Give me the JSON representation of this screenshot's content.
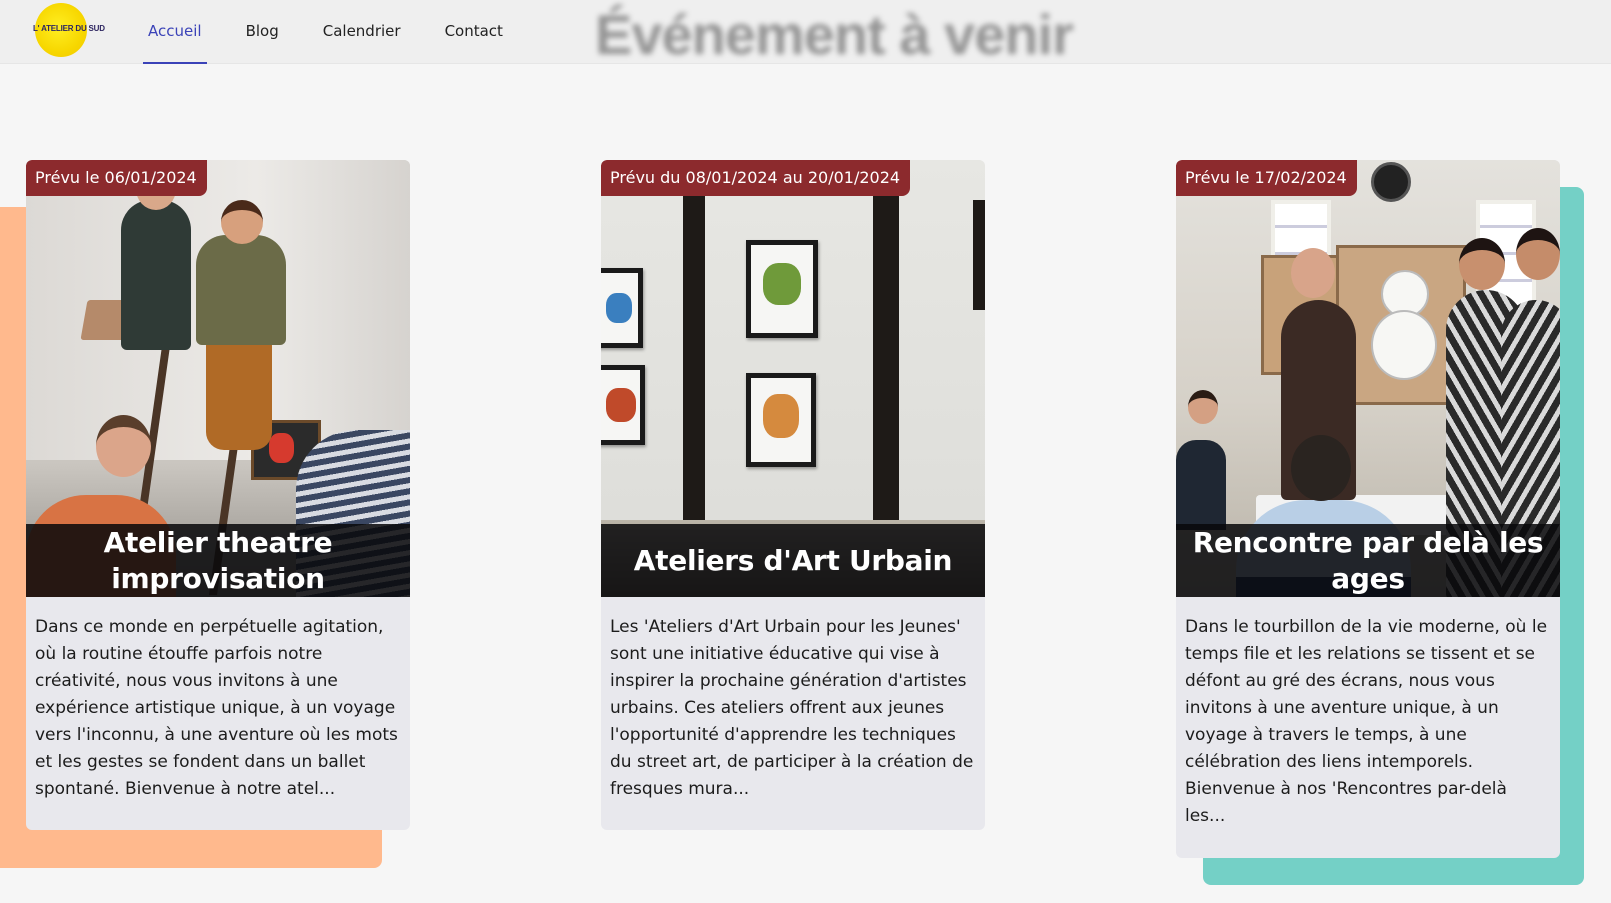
{
  "header": {
    "logo_text": "L' ATELIER DU SUD",
    "nav": [
      {
        "label": "Accueil",
        "active": true
      },
      {
        "label": "Blog",
        "active": false
      },
      {
        "label": "Calendrier",
        "active": false
      },
      {
        "label": "Contact",
        "active": false
      }
    ],
    "background_title": "Événement à venir"
  },
  "colors": {
    "accent": "#3b43b8",
    "badge": "#8c2a2d",
    "deco_orange": "#ffb98d",
    "deco_teal": "#74d0c6",
    "card_bg": "#e8e8ed"
  },
  "events": [
    {
      "date_label": "Prévu le 06/01/2024",
      "title": "Atelier theatre improvisation",
      "description": "Dans ce monde en perpétuelle agitation, où la routine étouffe parfois notre créativité, nous vous invitons à une expérience artistique unique, à un voyage vers l'inconnu, à une aventure où les mots et les gestes se fondent dans un ballet spontané. Bienvenue à notre atel..."
    },
    {
      "date_label": "Prévu du 08/01/2024 au 20/01/2024",
      "title": "Ateliers d'Art Urbain",
      "description": "Les 'Ateliers d'Art Urbain pour les Jeunes' sont une initiative éducative qui vise à inspirer la prochaine génération d'artistes urbains. Ces ateliers offrent aux jeunes l'opportunité d'apprendre les techniques du street art, de participer à la création de fresques mura..."
    },
    {
      "date_label": "Prévu le 17/02/2024",
      "title": "Rencontre par delà les ages",
      "description": "Dans le tourbillon de la vie moderne, où le temps file et les relations se tissent et se défont au gré des écrans, nous vous invitons à une aventure unique, à un voyage à travers le temps, à une célébration des liens intemporels. Bienvenue à nos 'Rencontres par-delà les..."
    }
  ]
}
